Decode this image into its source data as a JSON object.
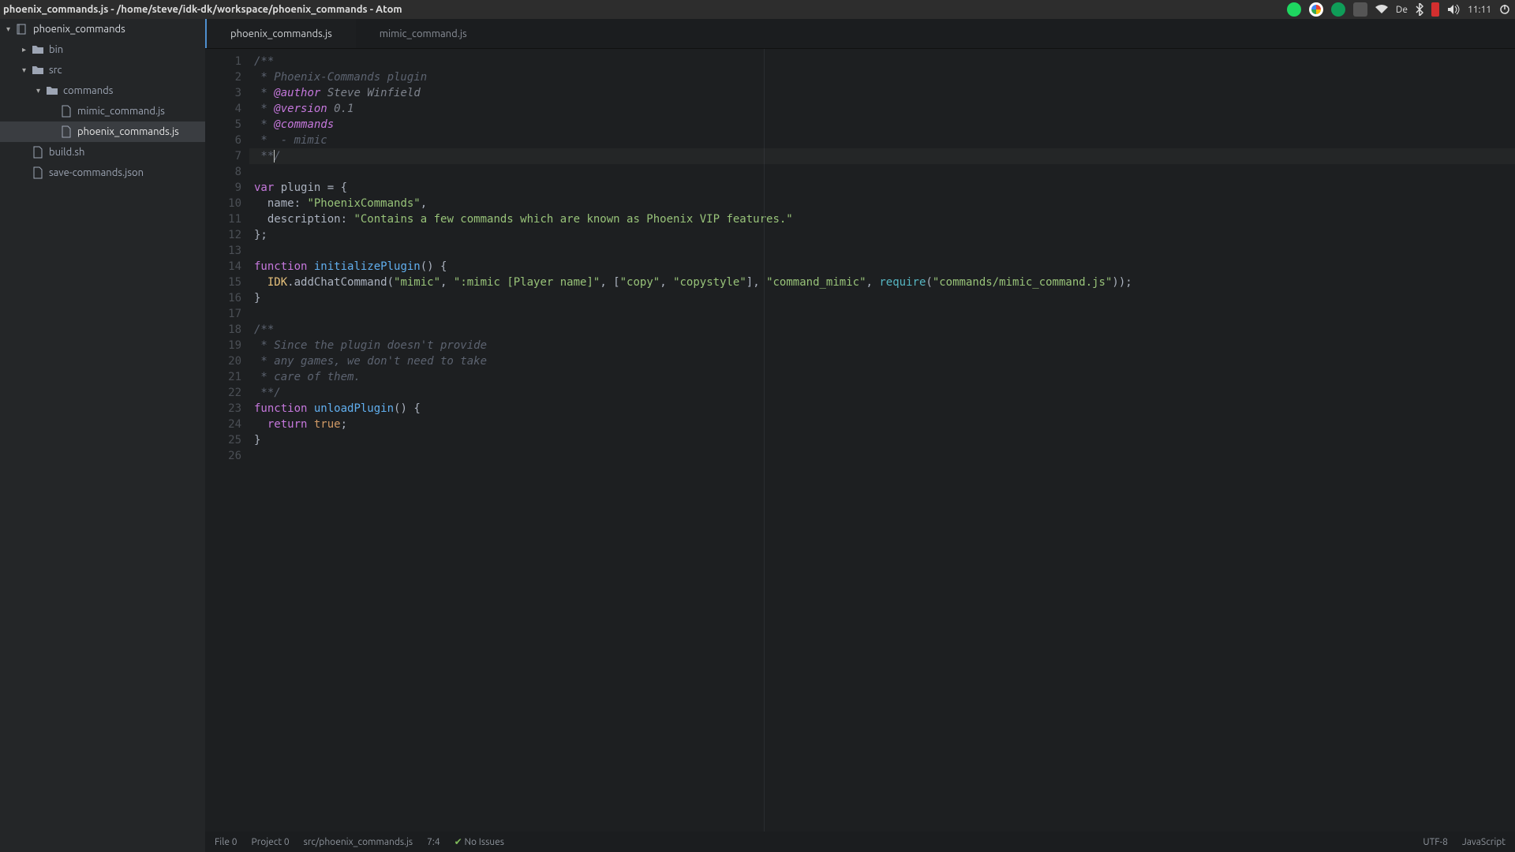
{
  "titlebar": {
    "title": "phoenix_commands.js - /home/steve/idk-dk/workspace/phoenix_commands - Atom"
  },
  "system_tray": {
    "clock": "11:11",
    "layout": "De"
  },
  "sidebar": {
    "project": "phoenix_commands",
    "nodes": [
      {
        "label": "bin",
        "type": "folder",
        "level": 1,
        "expanded": false
      },
      {
        "label": "src",
        "type": "folder",
        "level": 1,
        "expanded": true
      },
      {
        "label": "commands",
        "type": "folder",
        "level": 2,
        "expanded": true
      },
      {
        "label": "mimic_command.js",
        "type": "file",
        "level": 3,
        "selected": false
      },
      {
        "label": "phoenix_commands.js",
        "type": "file",
        "level": 3,
        "selected": true
      },
      {
        "label": "build.sh",
        "type": "file",
        "level": 1,
        "selected": false
      },
      {
        "label": "save-commands.json",
        "type": "file",
        "level": 1,
        "selected": false
      }
    ]
  },
  "tabs": [
    {
      "label": "phoenix_commands.js",
      "active": true
    },
    {
      "label": "mimic_command.js",
      "active": false
    }
  ],
  "cursor": {
    "line": 7,
    "column": 4
  },
  "code": {
    "lines": [
      [
        {
          "t": "/**",
          "c": "c-cm"
        }
      ],
      [
        {
          "t": " * Phoenix-Commands plugin",
          "c": "c-cm"
        }
      ],
      [
        {
          "t": " * ",
          "c": "c-cm"
        },
        {
          "t": "@author",
          "c": "c-tag"
        },
        {
          "t": " Steve Winfield",
          "c": "c-tagv"
        }
      ],
      [
        {
          "t": " * ",
          "c": "c-cm"
        },
        {
          "t": "@version",
          "c": "c-tag"
        },
        {
          "t": " 0.1",
          "c": "c-tagv"
        }
      ],
      [
        {
          "t": " * ",
          "c": "c-cm"
        },
        {
          "t": "@commands",
          "c": "c-tag"
        }
      ],
      [
        {
          "t": " *  - mimic",
          "c": "c-cm"
        }
      ],
      [
        {
          "t": " **/",
          "c": "c-cm"
        }
      ],
      [],
      [
        {
          "t": "var",
          "c": "c-kw"
        },
        {
          "t": " plugin ",
          "c": "c-pl"
        },
        {
          "t": "=",
          "c": "c-pl"
        },
        {
          "t": " {",
          "c": "c-pl"
        }
      ],
      [
        {
          "t": "  name",
          "c": "c-pl"
        },
        {
          "t": ": ",
          "c": "c-pl"
        },
        {
          "t": "\"PhoenixCommands\"",
          "c": "c-str"
        },
        {
          "t": ",",
          "c": "c-pl"
        }
      ],
      [
        {
          "t": "  description",
          "c": "c-pl"
        },
        {
          "t": ": ",
          "c": "c-pl"
        },
        {
          "t": "\"Contains a few commands which are known as Phoenix VIP features.\"",
          "c": "c-str"
        }
      ],
      [
        {
          "t": "};",
          "c": "c-pl"
        }
      ],
      [],
      [
        {
          "t": "function",
          "c": "c-kw"
        },
        {
          "t": " ",
          "c": "c-pl"
        },
        {
          "t": "initializePlugin",
          "c": "c-fn"
        },
        {
          "t": "() {",
          "c": "c-pl"
        }
      ],
      [
        {
          "t": "  IDK",
          "c": "c-id"
        },
        {
          "t": ".addChatCommand(",
          "c": "c-pl"
        },
        {
          "t": "\"mimic\"",
          "c": "c-str"
        },
        {
          "t": ", ",
          "c": "c-pl"
        },
        {
          "t": "\":mimic [Player name]\"",
          "c": "c-str"
        },
        {
          "t": ", [",
          "c": "c-pl"
        },
        {
          "t": "\"copy\"",
          "c": "c-str"
        },
        {
          "t": ", ",
          "c": "c-pl"
        },
        {
          "t": "\"copystyle\"",
          "c": "c-str"
        },
        {
          "t": "], ",
          "c": "c-pl"
        },
        {
          "t": "\"command_mimic\"",
          "c": "c-str"
        },
        {
          "t": ", ",
          "c": "c-pl"
        },
        {
          "t": "require",
          "c": "c-req"
        },
        {
          "t": "(",
          "c": "c-pl"
        },
        {
          "t": "\"commands/mimic_command.js\"",
          "c": "c-str"
        },
        {
          "t": "));",
          "c": "c-pl"
        }
      ],
      [
        {
          "t": "}",
          "c": "c-pl"
        }
      ],
      [],
      [
        {
          "t": "/**",
          "c": "c-cm"
        }
      ],
      [
        {
          "t": " * Since the plugin doesn't provide",
          "c": "c-cm"
        }
      ],
      [
        {
          "t": " * any games, we don't need to take",
          "c": "c-cm"
        }
      ],
      [
        {
          "t": " * care of them.",
          "c": "c-cm"
        }
      ],
      [
        {
          "t": " **/",
          "c": "c-cm"
        }
      ],
      [
        {
          "t": "function",
          "c": "c-kw"
        },
        {
          "t": " ",
          "c": "c-pl"
        },
        {
          "t": "unloadPlugin",
          "c": "c-fn"
        },
        {
          "t": "() {",
          "c": "c-pl"
        }
      ],
      [
        {
          "t": "  ",
          "c": "c-pl"
        },
        {
          "t": "return",
          "c": "c-kw"
        },
        {
          "t": " ",
          "c": "c-pl"
        },
        {
          "t": "true",
          "c": "c-bool"
        },
        {
          "t": ";",
          "c": "c-pl"
        }
      ],
      [
        {
          "t": "}",
          "c": "c-pl"
        }
      ],
      []
    ]
  },
  "statusbar": {
    "file_counter": "File 0",
    "project_counter": "Project 0",
    "path": "src/phoenix_commands.js",
    "position": "7:4",
    "lint": "No Issues",
    "encoding": "UTF-8",
    "language": "JavaScript"
  }
}
